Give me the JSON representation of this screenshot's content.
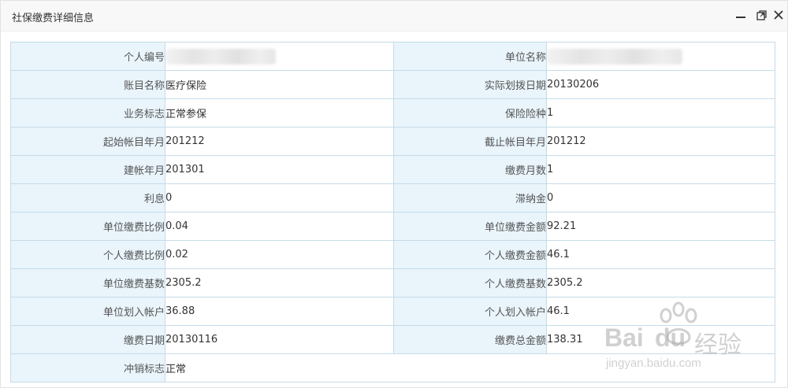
{
  "dialog": {
    "title": "社保缴费详细信息"
  },
  "rows": [
    {
      "label_left": "个人编号",
      "value_left": "",
      "label_right": "单位名称",
      "value_right": ""
    },
    {
      "label_left": "账目名称",
      "value_left": "医疗保险",
      "label_right": "实际划拨日期",
      "value_right": "20130206"
    },
    {
      "label_left": "业务标志",
      "value_left": "正常参保",
      "label_right": "保险险种",
      "value_right": "1"
    },
    {
      "label_left": "起始帐目年月",
      "value_left": "201212",
      "label_right": "截止帐目年月",
      "value_right": "201212"
    },
    {
      "label_left": "建帐年月",
      "value_left": "201301",
      "label_right": "缴费月数",
      "value_right": "1"
    },
    {
      "label_left": "利息",
      "value_left": "0",
      "label_right": "滞纳金",
      "value_right": "0"
    },
    {
      "label_left": "单位缴费比例",
      "value_left": "0.04",
      "label_right": "单位缴费金额",
      "value_right": "92.21"
    },
    {
      "label_left": "个人缴费比例",
      "value_left": "0.02",
      "label_right": "个人缴费金额",
      "value_right": "46.1"
    },
    {
      "label_left": "单位缴费基数",
      "value_left": "2305.2",
      "label_right": "个人缴费基数",
      "value_right": "2305.2"
    },
    {
      "label_left": "单位划入帐户",
      "value_left": "36.88",
      "label_right": "个人划入帐户",
      "value_right": "46.1"
    },
    {
      "label_left": "缴费日期",
      "value_left": "20130116",
      "label_right": "缴费总金额",
      "value_right": "138.31"
    }
  ],
  "last_row": {
    "label": "冲销标志",
    "value": "正常"
  },
  "icons": {
    "minimize": "minimize-icon",
    "maximize": "maximize-icon",
    "close": "close-icon"
  },
  "watermark": {
    "brand": "Bai",
    "brand_tail": "du",
    "cn": "经验",
    "url": "jingyan.baidu.com"
  }
}
